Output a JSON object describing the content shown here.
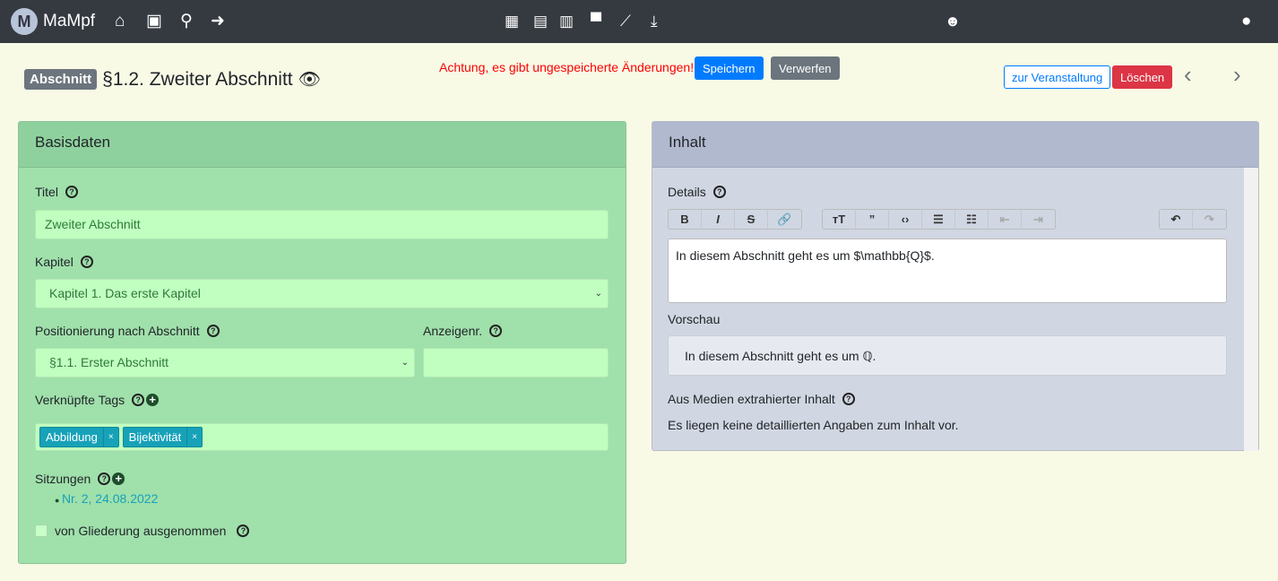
{
  "nav": {
    "brand": "MaMpf",
    "logo_letter": "M",
    "icons_left": [
      "home-icon",
      "profile-icon",
      "search-icon",
      "logout-icon"
    ],
    "icons_center": [
      "calendar-icon",
      "clipboard-icon",
      "newspaper-icon",
      "comment-icon",
      "chart-icon",
      "download-icon"
    ]
  },
  "header": {
    "badge": "Abschnitt",
    "title": "§1.2. Zweiter Abschnitt",
    "warning": "Achtung, es gibt ungespeicherte Änderungen!",
    "save": "Speichern",
    "discard": "Verwerfen",
    "to_event": "zur Veranstaltung",
    "delete": "Löschen"
  },
  "basis": {
    "header": "Basisdaten",
    "title_label": "Titel",
    "title_value": "Zweiter Abschnitt",
    "chapter_label": "Kapitel",
    "chapter_value": "Kapitel 1. Das erste Kapitel",
    "position_label": "Positionierung nach Abschnitt",
    "position_value": "§1.1. Erster Abschnitt",
    "display_label": "Anzeigenr.",
    "display_value": "",
    "tags_label": "Verknüpfte Tags",
    "tags": [
      "Abbildung",
      "Bijektivität"
    ],
    "sessions_label": "Sitzungen",
    "sessions": [
      "Nr. 2, 24.08.2022"
    ],
    "exclude_label": "von Gliederung ausgenommen"
  },
  "content": {
    "header": "Inhalt",
    "details_label": "Details",
    "details_text": "In diesem Abschnitt geht es um $\\mathbb{Q}$.",
    "preview_label": "Vorschau",
    "preview_text": "In diesem Abschnitt geht es um ℚ.",
    "extracted_label": "Aus Medien extrahierter Inhalt",
    "extracted_text": "Es liegen keine detaillierten Angaben zum Inhalt vor."
  },
  "colors": {
    "navbar": "#343a40",
    "basis_header": "#8fd19e",
    "basis_body": "#a0e0ab",
    "content_header": "#b1b9cf",
    "content_body": "#d1d7e2",
    "danger": "#dc3545",
    "primary": "#007bff"
  }
}
